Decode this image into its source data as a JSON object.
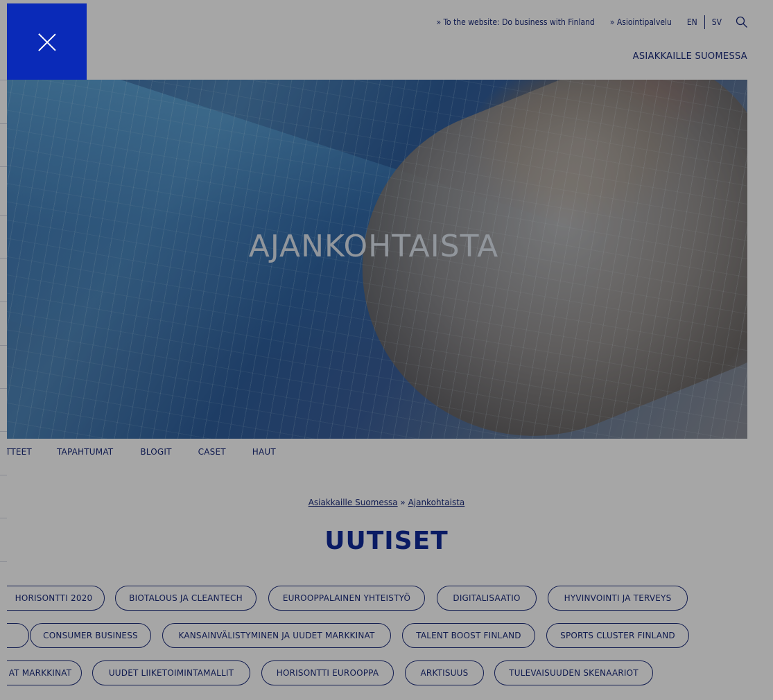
{
  "utility": {
    "website_link": "» To the website: Do business with Finland",
    "service_link": "» Asiointipalvelu",
    "lang_en": "EN",
    "lang_sv": "SV",
    "search_icon": "search-icon"
  },
  "main_nav": {
    "item": "ASIAKKAILLE SUOMESSA"
  },
  "hero": {
    "title": "AJANKOHTAISTA"
  },
  "subnav": [
    "TTEET",
    "TAPAHTUMAT",
    "BLOGIT",
    "CASET",
    "HAUT"
  ],
  "breadcrumb": {
    "home": "Asiakkaille Suomessa",
    "separator": "»",
    "current": "Ajankohtaista"
  },
  "page_title": "UUTISET",
  "tags": {
    "row1": [
      "HORISONTTI 2020",
      "BIOTALOUS JA CLEANTECH",
      "EUROOPPALAINEN YHTEISTYÖ",
      "DIGITALISAATIO",
      "HYVINVOINTI JA TERVEYS"
    ],
    "row2": [
      "",
      "CONSUMER BUSINESS",
      "KANSAINVÄLISTYMINEN JA UUDET MARKKINAT",
      "TALENT BOOST FINLAND",
      "SPORTS CLUSTER FINLAND"
    ],
    "row3": [
      "AT MARKKINAT",
      "UUDET LIIKETOIMINTAMALLIT",
      "HORISONTTI EUROOPPA",
      "ARKTISUUS",
      "TULEVAISUUDEN SKENAARIOT"
    ]
  },
  "close_icon": "close-icon",
  "colors": {
    "brand_blue": "#0a2ab8",
    "text_navy": "#1a2a7a",
    "title_blue": "#102a9a"
  }
}
